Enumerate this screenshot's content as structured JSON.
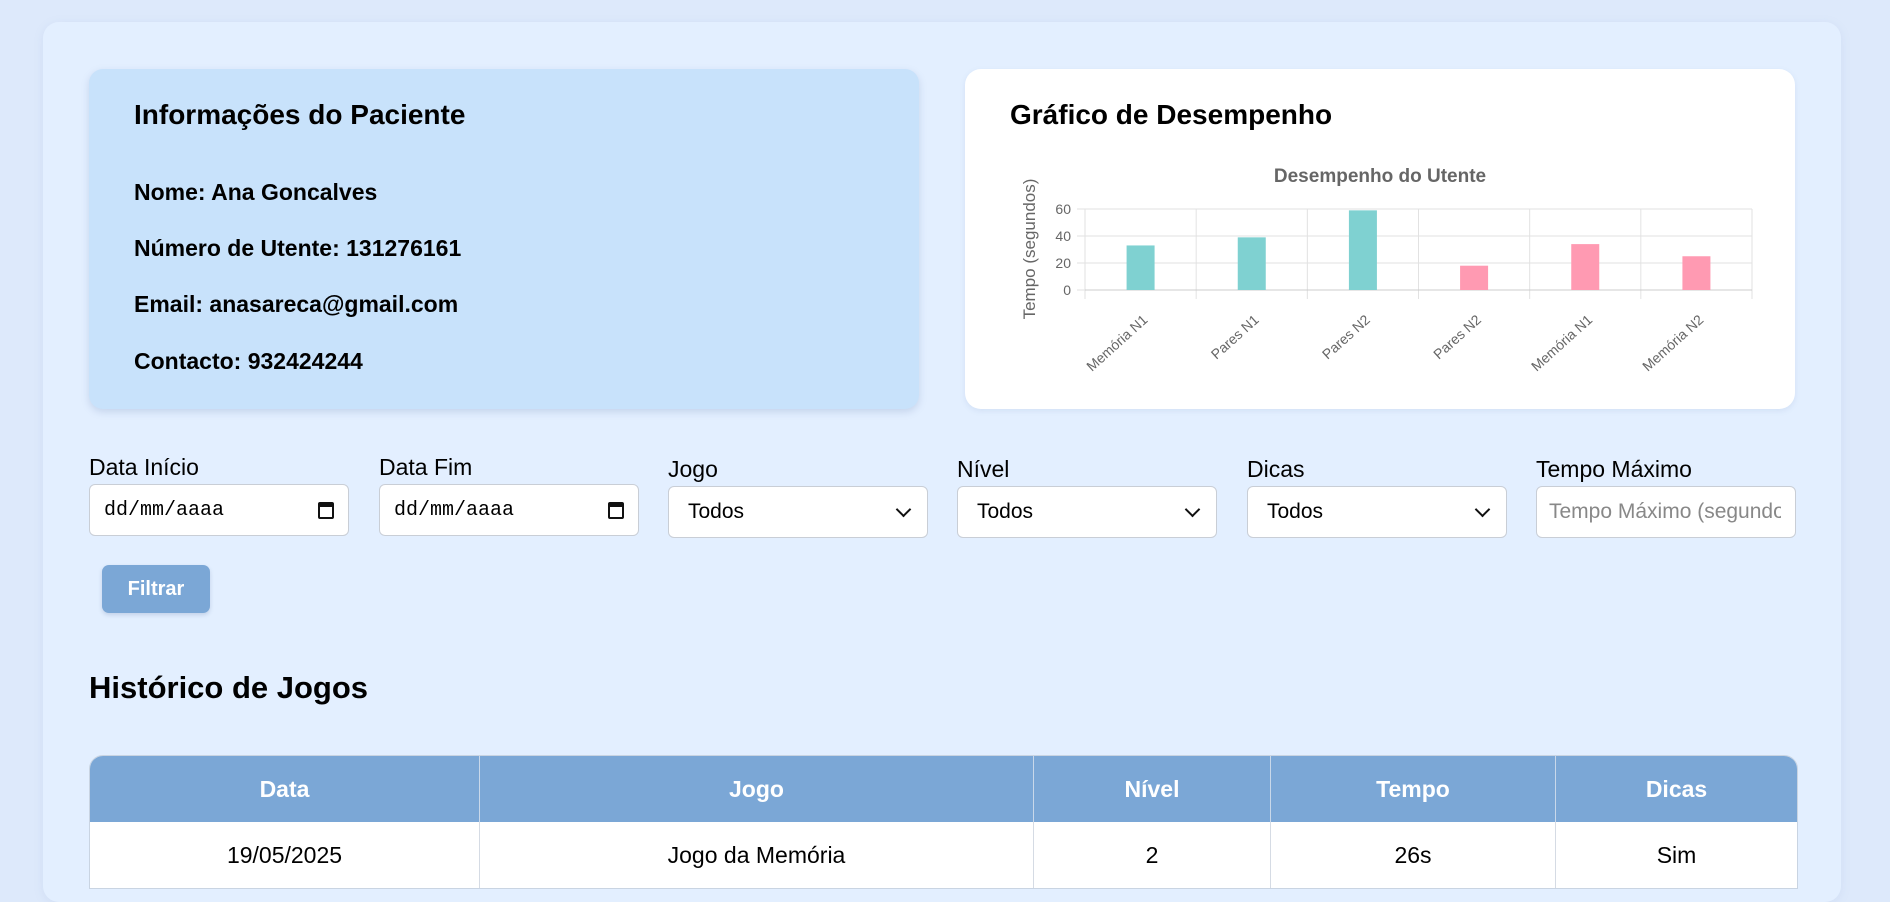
{
  "patient": {
    "title": "Informações do Paciente",
    "name_label": "Nome:",
    "name": "Ana Goncalves",
    "number_label": "Número de Utente:",
    "number": "131276161",
    "email_label": "Email:",
    "email": "anasareca@gmail.com",
    "contact_label": "Contacto:",
    "contact": "932424244"
  },
  "chart_section": {
    "title": "Gráfico de Desempenho"
  },
  "chart_data": {
    "type": "bar",
    "title": "Desempenho do Utente",
    "xlabel": "",
    "ylabel": "Tempo (segundos)",
    "categories": [
      "Memória N1",
      "Pares N1",
      "Pares N2",
      "Pares N2",
      "Memória N1",
      "Memória N2"
    ],
    "values": [
      33,
      39,
      59,
      18,
      34,
      25
    ],
    "bar_colors": [
      "#7fd1d1",
      "#7fd1d1",
      "#7fd1d1",
      "#ff9ab2",
      "#ff9ab2",
      "#ff9ab2"
    ],
    "ylim": [
      0,
      60
    ],
    "yticks": [
      0,
      20,
      40,
      60
    ],
    "grid": true
  },
  "filters": {
    "start_date": {
      "label": "Data Início",
      "value": "dd/mm/aaaa"
    },
    "end_date": {
      "label": "Data Fim",
      "value": "dd/mm/aaaa"
    },
    "game": {
      "label": "Jogo",
      "value": "Todos"
    },
    "level": {
      "label": "Nível",
      "value": "Todos"
    },
    "hints": {
      "label": "Dicas",
      "value": "Todos"
    },
    "max_time": {
      "label": "Tempo Máximo",
      "placeholder": "Tempo Máximo (segundos)"
    },
    "button_label": "Filtrar"
  },
  "history": {
    "title": "Histórico de Jogos",
    "columns": [
      "Data",
      "Jogo",
      "Nível",
      "Tempo",
      "Dicas"
    ],
    "rows": [
      [
        "19/05/2025",
        "Jogo da Memória",
        "2",
        "26s",
        "Sim"
      ]
    ]
  },
  "colors": {
    "page_bg": "#dde9fb",
    "patient_card_bg": "#c8e2fb",
    "accent": "#7ba7d6",
    "bar_teal": "#7fd1d1",
    "bar_pink": "#ff9ab2"
  }
}
